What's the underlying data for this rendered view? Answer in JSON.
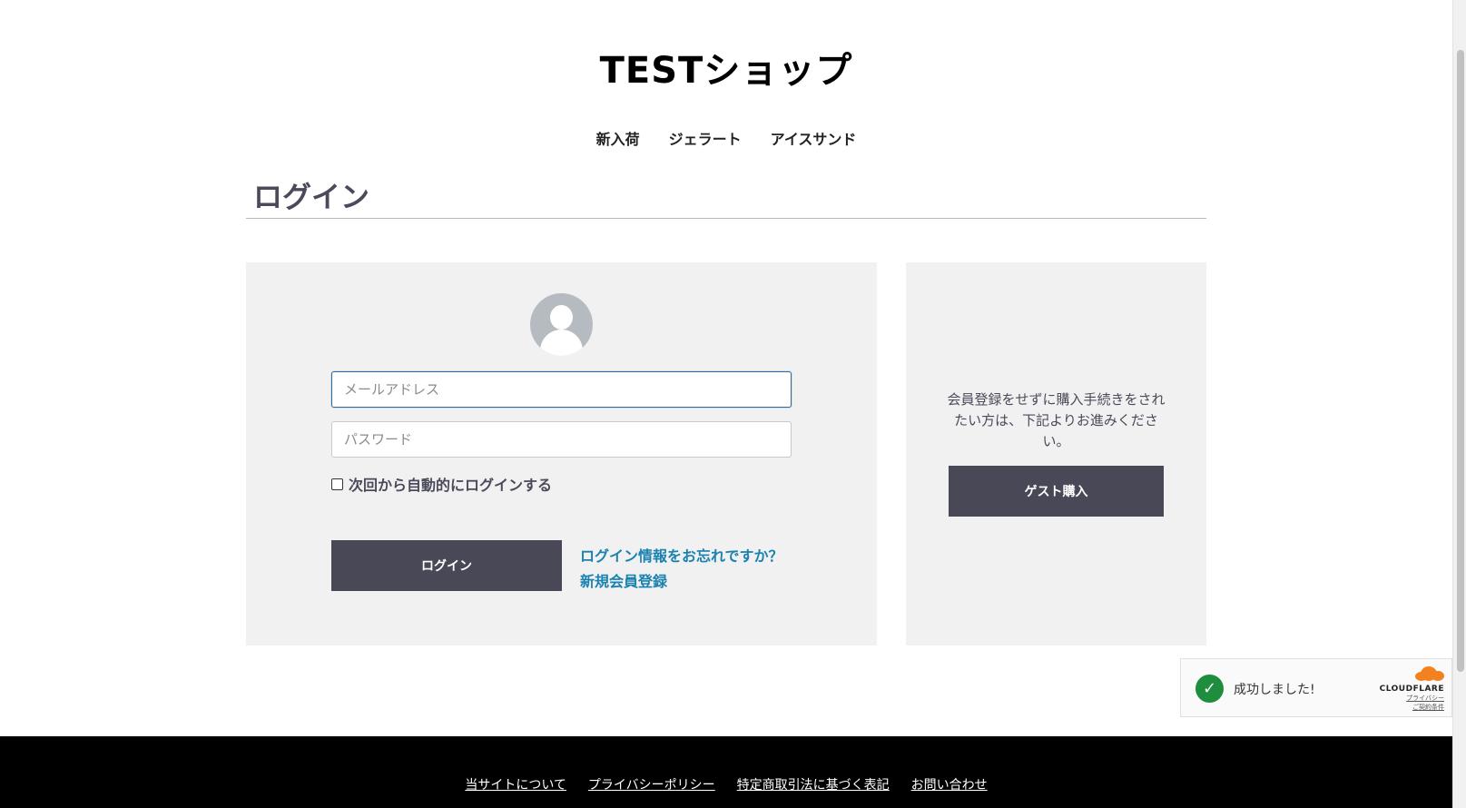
{
  "header": {
    "site_title": "TESTショップ",
    "nav": [
      "新入荷",
      "ジェラート",
      "アイスサンド"
    ]
  },
  "page": {
    "title": "ログイン"
  },
  "login": {
    "email_placeholder": "メールアドレス",
    "password_placeholder": "パスワード",
    "remember_label": "次回から自動的にログインする",
    "login_button": "ログイン",
    "forgot_link": "ログイン情報をお忘れですか？",
    "register_link": "新規会員登録"
  },
  "guest": {
    "text": "会員登録をせずに購入手続きをされたい方は、下記よりお進みください。",
    "button": "ゲスト購入"
  },
  "cloudflare": {
    "status": "成功しました!",
    "brand": "CLOUDFLARE",
    "privacy": "プライバシー",
    "terms": "ご契約条件",
    "success_color": "#1e8e3e",
    "brand_color": "#f48120"
  },
  "footer": {
    "links": [
      "当サイトについて",
      "プライバシーポリシー",
      "特定商取引法に基づく表記",
      "お問い合わせ"
    ]
  },
  "colors": {
    "button_bg": "#494857",
    "link": "#1a82b0",
    "panel_bg": "#f1f1f1"
  }
}
